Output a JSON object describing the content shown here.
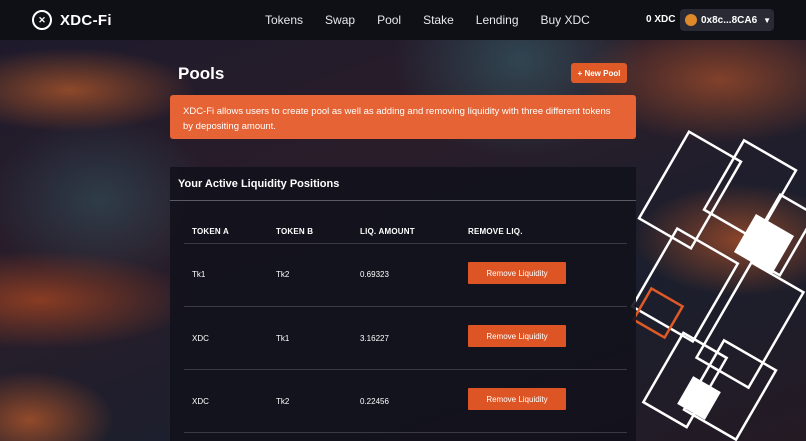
{
  "header": {
    "brand": "XDC-Fi",
    "brand_icon": "xdc-logo-icon",
    "nav": [
      "Tokens",
      "Swap",
      "Pool",
      "Stake",
      "Lending",
      "Buy XDC"
    ],
    "balance": "0 XDC",
    "wallet_address": "0x8c...8CA6",
    "wallet_icon": "wallet-avatar-icon"
  },
  "page": {
    "title": "Pools",
    "new_pool_label": "+ New Pool",
    "banner_text": "XDC-Fi allows users to create pool as well as adding and removing liquidity with three different tokens by depositing amount."
  },
  "positions": {
    "title": "Your Active Liquidity Positions",
    "columns": [
      "TOKEN A",
      "TOKEN B",
      "LIQ. AMOUNT",
      "REMOVE LIQ."
    ],
    "rows": [
      {
        "token_a": "Tk1",
        "token_b": "Tk2",
        "amount": "0.69323",
        "action": "Remove Liquidity"
      },
      {
        "token_a": "XDC",
        "token_b": "Tk1",
        "amount": "3.16227",
        "action": "Remove Liquidity"
      },
      {
        "token_a": "XDC",
        "token_b": "Tk2",
        "amount": "0.22456",
        "action": "Remove Liquidity"
      }
    ]
  },
  "colors": {
    "accent": "#e05a28",
    "banner": "#e56334",
    "header": "#0f0f16"
  }
}
